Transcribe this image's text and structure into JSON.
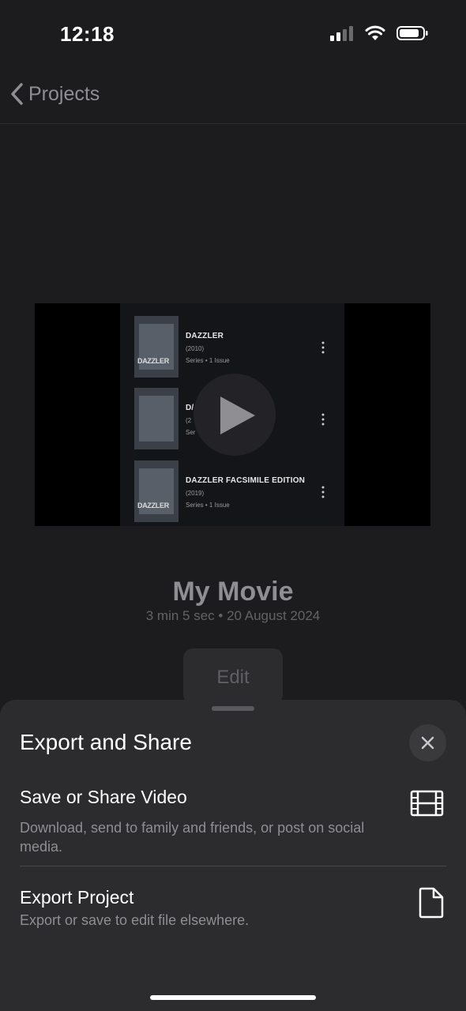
{
  "status": {
    "time": "12:18"
  },
  "nav": {
    "back_label": "Projects"
  },
  "video": {
    "comics": [
      {
        "title": "DAZZLER",
        "year": "(2010)",
        "meta": "Series • 1 Issue",
        "cover_text": "DAZZLER"
      },
      {
        "title": "D/",
        "year": "(2",
        "meta": "Ser",
        "cover_text": ""
      },
      {
        "title": "DAZZLER FACSIMILE EDITION",
        "year": "(2019)",
        "meta": "Series • 1 Issue",
        "cover_text": "DAZZLER"
      }
    ]
  },
  "project": {
    "title": "My Movie",
    "meta": "3 min 5 sec • 20 August 2024",
    "edit_label": "Edit"
  },
  "sheet": {
    "title": "Export and Share",
    "options": [
      {
        "title": "Save or Share Video",
        "subtitle": "Download, send to family and friends, or post on social media.",
        "icon": "film-icon"
      },
      {
        "title": "Export Project",
        "subtitle": "Export or save to edit file elsewhere.",
        "icon": "document-icon"
      }
    ]
  }
}
